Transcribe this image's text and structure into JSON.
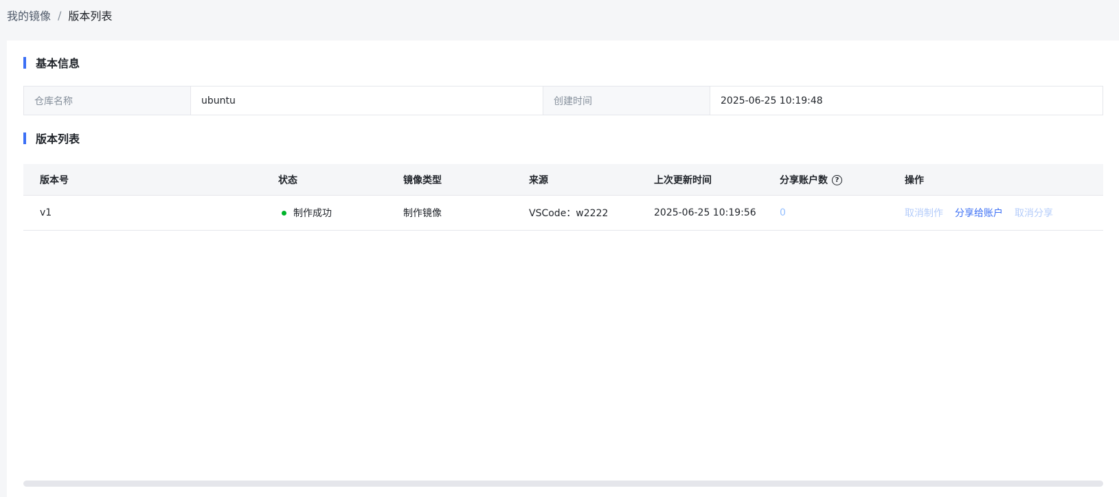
{
  "breadcrumb": {
    "parent": "我的镜像",
    "separator": "/",
    "current": "版本列表"
  },
  "basic_info": {
    "title": "基本信息",
    "fields": [
      {
        "label": "仓库名称",
        "value": "ubuntu"
      },
      {
        "label": "创建时间",
        "value": "2025-06-25 10:19:48"
      }
    ]
  },
  "version_list": {
    "title": "版本列表",
    "columns": [
      "版本号",
      "状态",
      "镜像类型",
      "来源",
      "上次更新时间",
      "分享账户数",
      "操作"
    ],
    "help_icon_glyph": "?",
    "rows": [
      {
        "version": "v1",
        "status": "制作成功",
        "image_type": "制作镜像",
        "source": "VSCode：w2222",
        "updated_at": "2025-06-25 10:19:56",
        "share_count": "0",
        "actions": [
          "取消制作",
          "分享给账户",
          "取消分享"
        ]
      }
    ]
  },
  "colors": {
    "accent": "#3b6ff5",
    "status_success": "#00b42a",
    "disabled_link": "#b4ccfa"
  }
}
